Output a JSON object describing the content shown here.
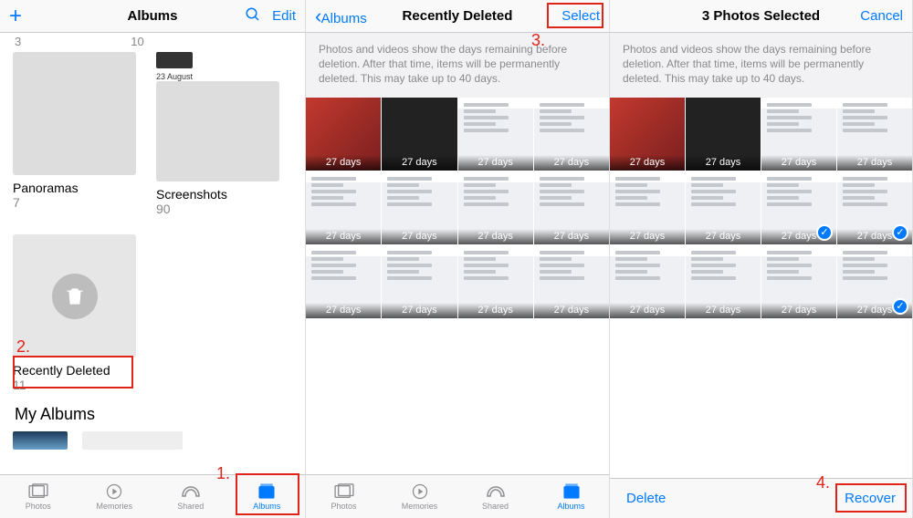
{
  "accent": "#007aff",
  "annotation_color": "#e2231a",
  "screen1": {
    "title": "Albums",
    "edit": "Edit",
    "row1": [
      {
        "count": "3"
      },
      {
        "count": "10"
      }
    ],
    "albums": [
      {
        "title": "Panoramas",
        "count": "7"
      },
      {
        "title": "Screenshots",
        "count": "90",
        "date_label": "23 August"
      },
      {
        "title": "Recently Deleted",
        "count": "11"
      }
    ],
    "my_albums_label": "My Albums",
    "tabs": [
      "Photos",
      "Memories",
      "Shared",
      "Albums"
    ],
    "active_tab": "Albums",
    "anno_numbers": {
      "n1": "1.",
      "n2": "2."
    }
  },
  "screen2": {
    "back_label": "Albums",
    "title": "Recently Deleted",
    "select": "Select",
    "info": "Photos and videos show the days remaining before deletion. After that time, items will be permanently deleted. This may take up to 40 days.",
    "days_label": "27 days",
    "tabs": [
      "Photos",
      "Memories",
      "Shared",
      "Albums"
    ],
    "active_tab": "Albums",
    "anno_numbers": {
      "n3": "3."
    }
  },
  "screen3": {
    "title": "3 Photos Selected",
    "cancel": "Cancel",
    "info": "Photos and videos show the days remaining before deletion. After that time, items will be permanently deleted. This may take up to 40 days.",
    "days_label": "27 days",
    "delete": "Delete",
    "recover": "Recover",
    "anno_numbers": {
      "n4": "4."
    }
  }
}
